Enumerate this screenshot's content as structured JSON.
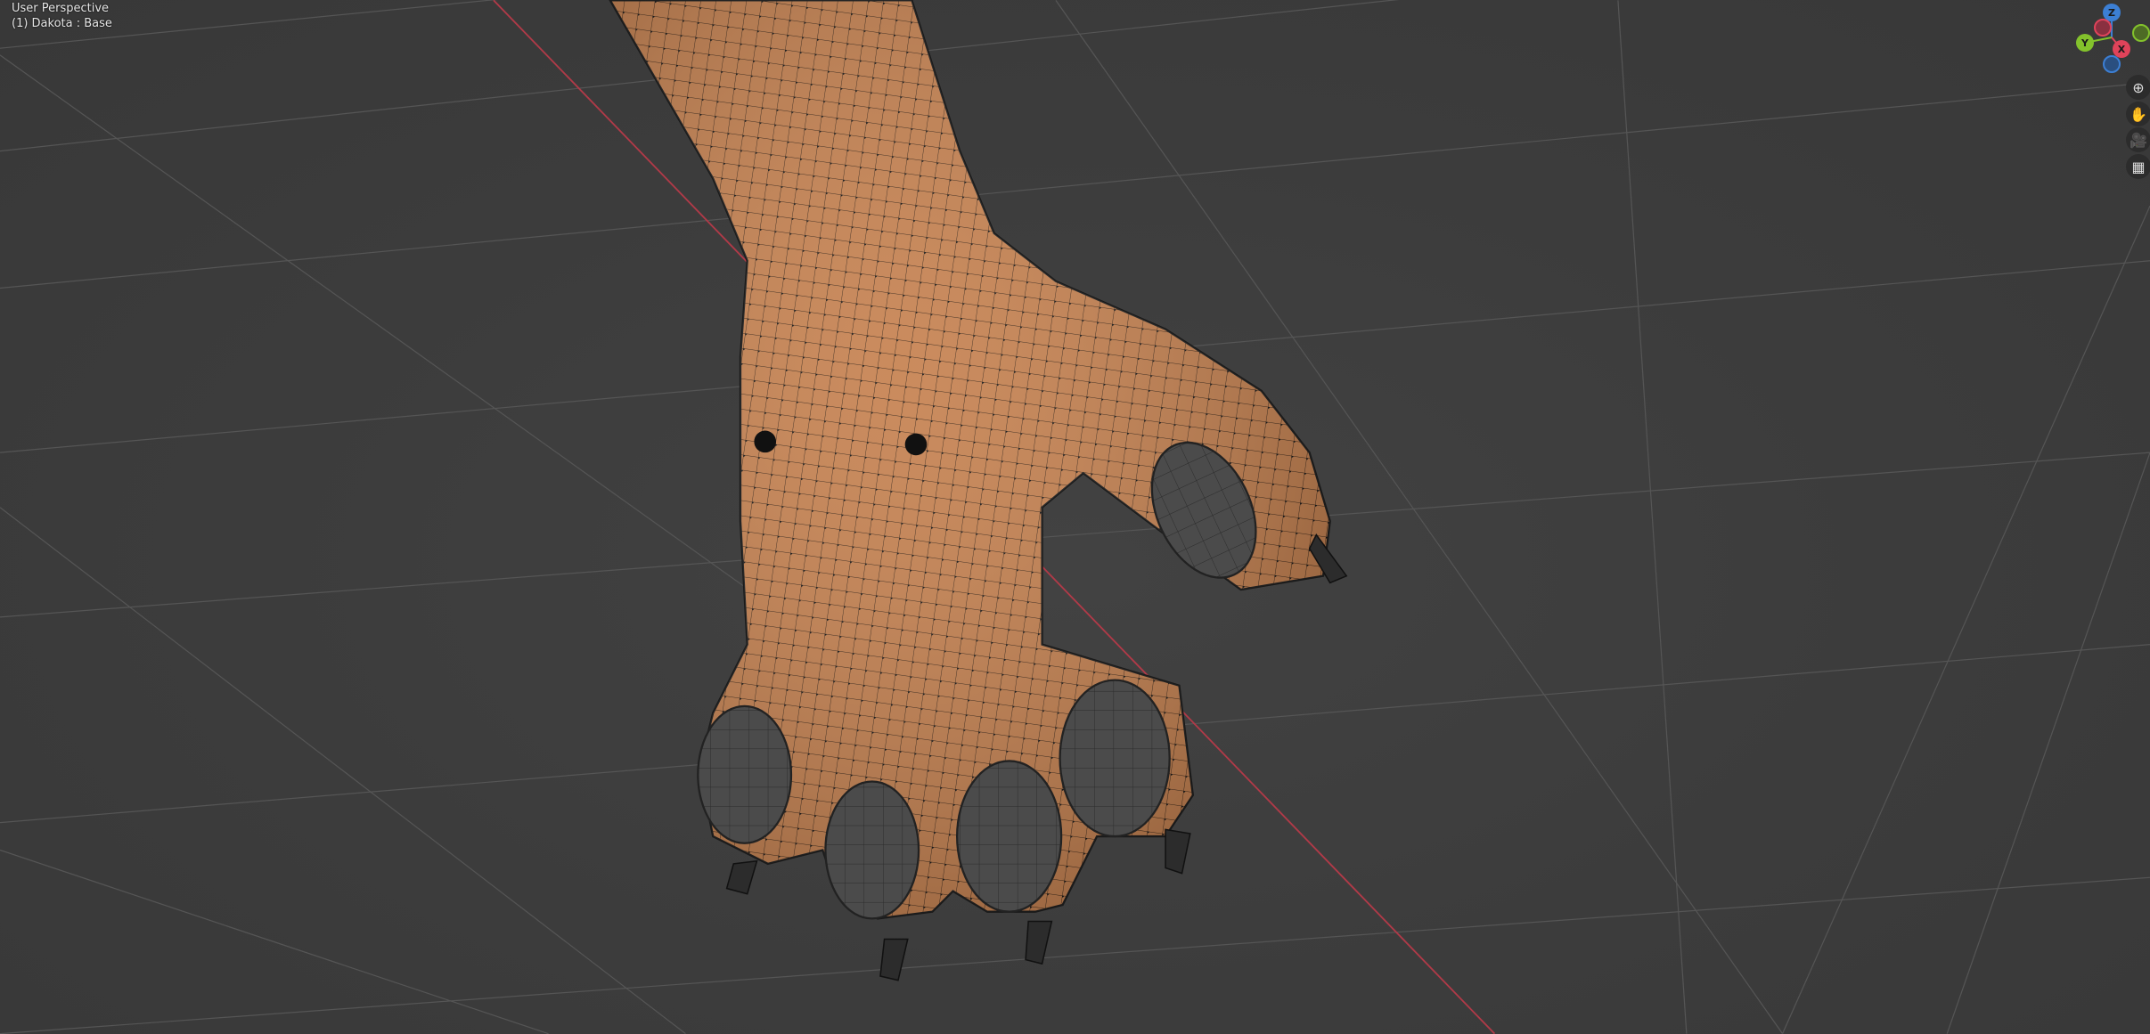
{
  "viewport": {
    "view_label": "User Perspective",
    "object_label": "(1) Dakota : Base"
  },
  "gizmo": {
    "x_label": "X",
    "y_label": "Y",
    "z_label": "Z",
    "x_color": "#e0435a",
    "y_color": "#83c22c",
    "z_color": "#3c7fd4"
  },
  "nav_buttons": [
    {
      "icon": "zoom-icon",
      "glyph": "⊕"
    },
    {
      "icon": "hand-pan-icon",
      "glyph": "✋"
    },
    {
      "icon": "camera-icon",
      "glyph": "🎥"
    },
    {
      "icon": "grid-ortho-icon",
      "glyph": "▦"
    }
  ],
  "colors": {
    "skin": "#c6814f",
    "pad": "#4a4a4a",
    "background": "#3d3d3d",
    "x_axis": "#b03a48"
  }
}
